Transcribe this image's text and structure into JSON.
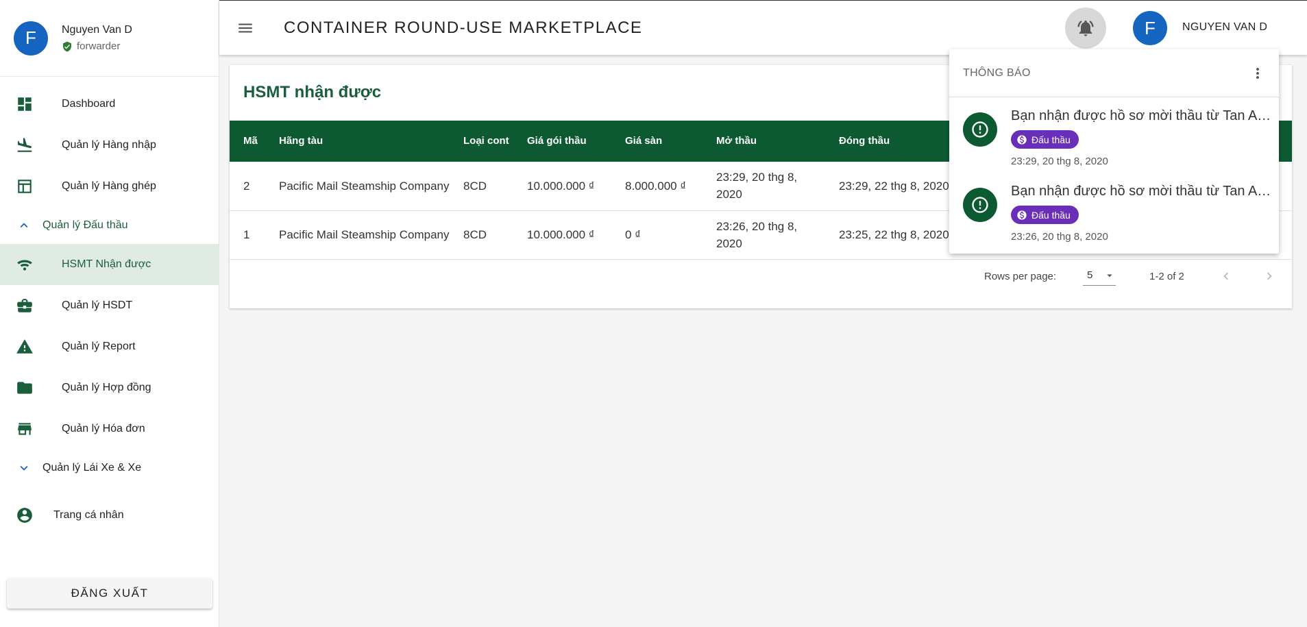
{
  "sidebar": {
    "profile": {
      "initial": "F",
      "name": "Nguyen Van D",
      "role": "forwarder"
    },
    "items": [
      {
        "label": "Dashboard",
        "icon": "dashboard-icon"
      },
      {
        "label": "Quản lý Hàng nhập",
        "icon": "flight-land-icon"
      },
      {
        "label": "Quản lý Hàng ghép",
        "icon": "table-icon"
      },
      {
        "label": "Quản lý Đấu thầu",
        "icon": "chevron-up-icon"
      },
      {
        "label": "HSMT Nhận được",
        "icon": "signal-icon"
      },
      {
        "label": "Quản lý HSDT",
        "icon": "briefcase-icon"
      },
      {
        "label": "Quản lý Report",
        "icon": "warning-icon"
      },
      {
        "label": "Quản lý Hợp đồng",
        "icon": "folder-icon"
      },
      {
        "label": "Quản lý Hóa đơn",
        "icon": "store-icon"
      },
      {
        "label": "Quản lý Lái Xe & Xe",
        "icon": "chevron-down-icon"
      },
      {
        "label": "Trang cá nhân",
        "icon": "account-circle-icon"
      }
    ],
    "logout_label": "ĐĂNG XUẤT"
  },
  "header": {
    "title": "CONTAINER ROUND-USE MARKETPLACE",
    "user_initial": "F",
    "user_name": "NGUYEN VAN D"
  },
  "main": {
    "title": "HSMT nhận được",
    "columns": [
      "Mã",
      "Hãng tàu",
      "Loại cont",
      "Giá gói thầu",
      "Giá sàn",
      "Mở thầu",
      "Đóng thầu"
    ],
    "rows": [
      {
        "ma": "2",
        "hang": "Pacific Mail Steamship Company",
        "loai": "8CD",
        "gia": "10.000.000 ₫",
        "san": "8.000.000 ₫",
        "mo": "23:29, 20 thg 8, 2020",
        "dong": "23:29, 22 thg 8, 2020"
      },
      {
        "ma": "1",
        "hang": "Pacific Mail Steamship Company",
        "loai": "8CD",
        "gia": "10.000.000 ₫",
        "san": "0 ₫",
        "mo": "23:26, 20 thg 8, 2020",
        "dong": "23:25, 22 thg 8, 2020"
      }
    ],
    "pagination": {
      "rows_per_page_label": "Rows per page:",
      "rows_per_page": "5",
      "range": "1-2 of 2"
    }
  },
  "notifications": {
    "title": "THÔNG BÁO",
    "items": [
      {
        "text": "Bạn nhận được hồ sơ mời thầu từ Tan An Tan An",
        "tag": "Đấu thầu",
        "time": "23:29, 20 thg 8, 2020"
      },
      {
        "text": "Bạn nhận được hồ sơ mời thầu từ Tan An Tan An",
        "tag": "Đấu thầu",
        "time": "23:26, 20 thg 8, 2020"
      }
    ]
  },
  "colors": {
    "primary_green": "#0d5a32",
    "avatar_blue": "#1565c0",
    "chip_purple": "#6a2fb8",
    "active_bg": "#e0ebe4"
  }
}
